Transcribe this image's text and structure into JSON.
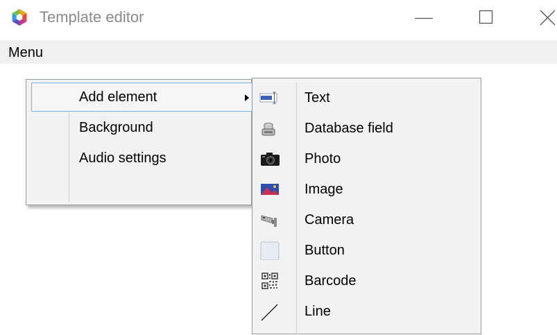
{
  "window": {
    "title": "Template editor",
    "icon": "app-logo-icon",
    "controls": {
      "minimize_icon": "minimize-icon",
      "maximize_icon": "maximize-icon",
      "close_icon": "close-icon"
    }
  },
  "menubar": {
    "menu_label": "Menu"
  },
  "dropdown": {
    "items": [
      {
        "label": "Add element",
        "has_submenu": true,
        "highlighted": true
      },
      {
        "label": "Background"
      },
      {
        "label": "Audio settings"
      }
    ]
  },
  "submenu": {
    "items": [
      {
        "label": "Text",
        "icon": "text-field-icon"
      },
      {
        "label": "Database field",
        "icon": "database-icon"
      },
      {
        "label": "Photo",
        "icon": "photo-camera-icon"
      },
      {
        "label": "Image",
        "icon": "image-icon"
      },
      {
        "label": "Camera",
        "icon": "security-camera-icon"
      },
      {
        "label": "Button",
        "icon": "button-icon"
      },
      {
        "label": "Barcode",
        "icon": "qr-code-icon"
      },
      {
        "label": "Line",
        "icon": "line-icon"
      }
    ]
  },
  "colors": {
    "highlight_border": "#7db4e2",
    "menubar_bg": "#f0f0f0",
    "menu_bg": "#f2f2f2"
  }
}
